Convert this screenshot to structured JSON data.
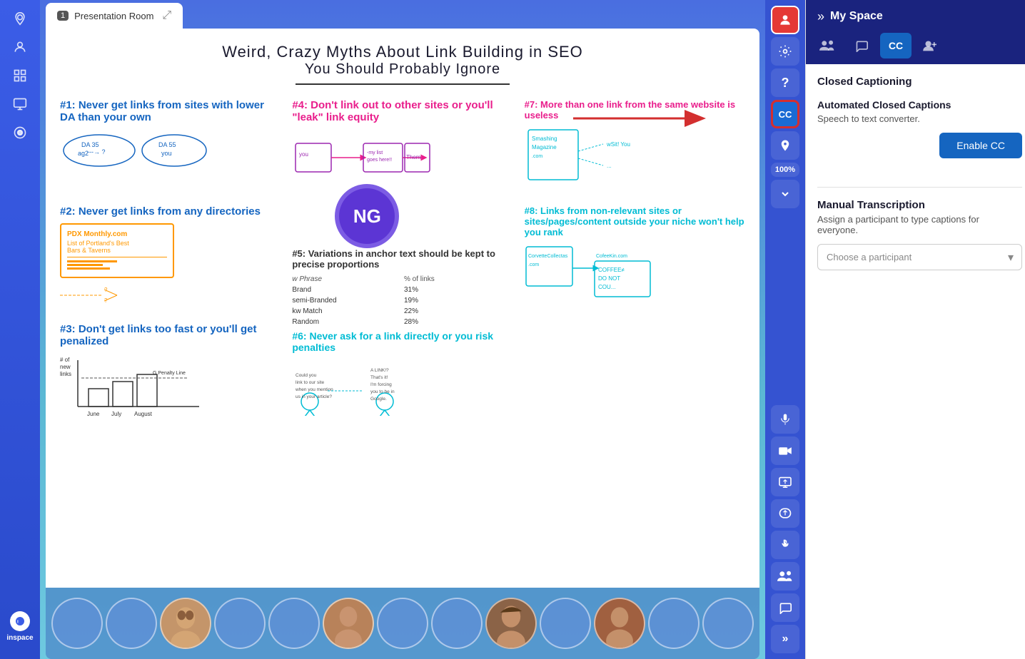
{
  "app": {
    "logo": "inspace",
    "logo_icon": "◎"
  },
  "tab": {
    "number": "1",
    "title": "Presentation Room",
    "close_icon": "⤢"
  },
  "left_sidebar": {
    "icons": [
      {
        "name": "location-pin-icon",
        "symbol": "📍",
        "active": false
      },
      {
        "name": "person-icon",
        "symbol": "👤",
        "active": false
      },
      {
        "name": "grid-icon",
        "symbol": "⊞",
        "active": false
      },
      {
        "name": "monitor-icon",
        "symbol": "🖥",
        "active": false
      },
      {
        "name": "record-icon",
        "symbol": "⏺",
        "active": false
      }
    ]
  },
  "whiteboard": {
    "title_line1": "Weird, Crazy Myths About Link Building in SEO",
    "title_line2": "You Should Probably Ignore",
    "ng_initials": "NG",
    "content_sections": [
      "#1: Never get links from sites with lower DA than your own",
      "#2: Never get links from any directories",
      "#3: Don't get links too fast or you'll get penalized",
      "#4: Don't link out to other sites or you'll \"leak\" link equity",
      "#5: Variations in anchor text should be kept to precise proportions",
      "#6: Never ask for a link directly or you risk penalties",
      "#7: More than one link from the same website is useless",
      "#8: Links from non-relevant sites or sites/pages/content outside your niche won't help you rank"
    ]
  },
  "right_toolbar": {
    "icons": [
      {
        "name": "profile-red-icon",
        "symbol": "👤",
        "style": "active-red"
      },
      {
        "name": "settings-icon",
        "symbol": "⚙",
        "style": "normal"
      },
      {
        "name": "help-icon",
        "symbol": "?",
        "style": "normal"
      },
      {
        "name": "cc-icon",
        "symbol": "CC",
        "style": "cc-highlighted"
      },
      {
        "name": "location-icon",
        "symbol": "📍",
        "style": "normal"
      },
      {
        "name": "zoom-icon",
        "symbol": "100%",
        "style": "zoom"
      },
      {
        "name": "chevron-down-icon",
        "symbol": "▾",
        "style": "normal"
      }
    ],
    "zoom_value": "100%"
  },
  "bottom_toolbar": {
    "icons": [
      {
        "name": "microphone-icon",
        "symbol": "🎤"
      },
      {
        "name": "camera-icon",
        "symbol": "📷"
      },
      {
        "name": "screen-share-icon",
        "symbol": "📺"
      },
      {
        "name": "broadcast-icon",
        "symbol": "📢"
      },
      {
        "name": "hand-icon",
        "symbol": "✋"
      },
      {
        "name": "people-icon",
        "symbol": "👥"
      },
      {
        "name": "chat-icon",
        "symbol": "💬"
      },
      {
        "name": "chevron-right-expand-icon",
        "symbol": "»"
      }
    ]
  },
  "my_space": {
    "title": "My Space",
    "chevron": "»",
    "tabs": [
      {
        "name": "tab-people",
        "symbol": "👥",
        "active": false
      },
      {
        "name": "tab-chat",
        "symbol": "💬",
        "active": false
      },
      {
        "name": "tab-cc",
        "label": "CC",
        "active": true
      },
      {
        "name": "tab-add-person",
        "symbol": "👤+",
        "active": false
      }
    ],
    "closed_captioning": {
      "section_title": "Closed Captioning",
      "automated_title": "Automated Closed Captions",
      "automated_desc": "Speech to text converter.",
      "enable_btn_label": "Enable CC",
      "manual_title": "Manual Transcription",
      "manual_desc": "Assign a participant to type captions for everyone.",
      "participant_placeholder": "Choose a participant"
    }
  },
  "participants": [
    {
      "id": 1,
      "has_photo": false
    },
    {
      "id": 2,
      "has_photo": false
    },
    {
      "id": 3,
      "has_photo": true,
      "color": "#b0855a"
    },
    {
      "id": 4,
      "has_photo": false
    },
    {
      "id": 5,
      "has_photo": false
    },
    {
      "id": 6,
      "has_photo": true,
      "color": "#c4956a"
    },
    {
      "id": 7,
      "has_photo": false
    },
    {
      "id": 8,
      "has_photo": false
    },
    {
      "id": 9,
      "has_photo": true,
      "color": "#c4825a"
    },
    {
      "id": 10,
      "has_photo": false
    },
    {
      "id": 11,
      "has_photo": true,
      "color": "#b07050"
    },
    {
      "id": 12,
      "has_photo": false
    },
    {
      "id": 13,
      "has_photo": false
    }
  ]
}
